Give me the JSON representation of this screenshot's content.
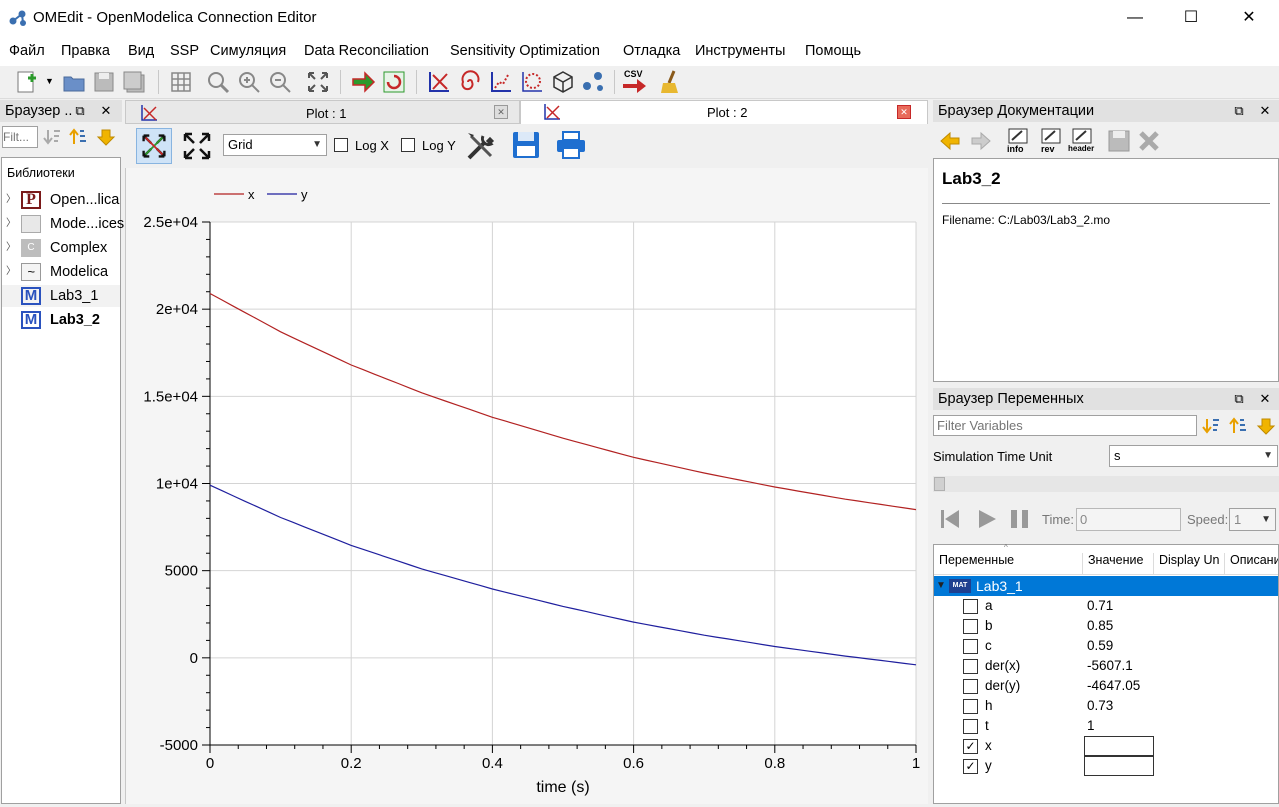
{
  "window": {
    "title": "OMEdit - OpenModelica Connection Editor",
    "minimize": "—",
    "maximize": "☐",
    "close": "✕"
  },
  "menu": [
    "Файл",
    "Правка",
    "Вид",
    "SSP",
    "Симуляция",
    "Data Reconciliation",
    "Sensitivity Optimization",
    "Отладка",
    "Инструменты",
    "Помощь"
  ],
  "toolbar": {
    "csv_label": "CSV"
  },
  "library_browser": {
    "title": "Браузер ..",
    "filter_placeholder": "Filt...",
    "section_label": "Библиотеки",
    "items": [
      {
        "label": "Open...lica",
        "icon": "P"
      },
      {
        "label": "Mode...ices",
        "icon": ""
      },
      {
        "label": "Complex",
        "icon": "C"
      },
      {
        "label": "Modelica",
        "icon": "~"
      },
      {
        "label": "Lab3_1",
        "icon": "M"
      },
      {
        "label": "Lab3_2",
        "icon": "M"
      }
    ]
  },
  "plot_tabs": [
    {
      "label": "Plot : 1",
      "close": "✕"
    },
    {
      "label": "Plot : 2",
      "close": "✕"
    }
  ],
  "plot_toolbar": {
    "grid_value": "Grid",
    "logx_label": "Log X",
    "logy_label": "Log Y"
  },
  "chart_data": {
    "type": "line",
    "xlabel": "time (s)",
    "ylabel": "",
    "xlim": [
      0,
      1
    ],
    "ylim": [
      -5000,
      25000
    ],
    "x_ticks": [
      "0",
      "0.2",
      "0.4",
      "0.6",
      "0.8",
      "1"
    ],
    "y_ticks": [
      "-5000",
      "0",
      "5000",
      "1e+04",
      "1.5e+04",
      "2e+04",
      "2.5e+04"
    ],
    "grid": true,
    "legend": "top-left",
    "x": [
      0,
      0.1,
      0.2,
      0.3,
      0.4,
      0.5,
      0.6,
      0.7,
      0.8,
      0.9,
      1.0
    ],
    "series": [
      {
        "name": "x",
        "color": "#b22222",
        "values": [
          20900,
          18700,
          16800,
          15200,
          13800,
          12600,
          11500,
          10600,
          9800,
          9100,
          8500
        ]
      },
      {
        "name": "y",
        "color": "#1f1f9e",
        "values": [
          9900,
          8050,
          6450,
          5100,
          3950,
          2950,
          2050,
          1300,
          650,
          100,
          -400
        ]
      }
    ]
  },
  "doc_browser": {
    "title": "Браузер Документации",
    "heading": "Lab3_2",
    "filename": "Filename: C:/Lab03/Lab3_2.mo",
    "btn_info": "info",
    "btn_rev": "rev",
    "btn_header": "header"
  },
  "var_browser": {
    "title": "Браузер Переменных",
    "filter_placeholder": "Filter Variables",
    "time_unit_label": "Simulation Time Unit",
    "time_unit_value": "s",
    "time_label": "Time:",
    "time_value": "0",
    "speed_label": "Speed:",
    "speed_value": "1",
    "columns": [
      "Переменные",
      "Значение",
      "Display Un",
      "Описани"
    ],
    "root": "Lab3_1",
    "root_badge": "MAT",
    "rows": [
      {
        "name": "a",
        "value": "0.71",
        "checked": false
      },
      {
        "name": "b",
        "value": "0.85",
        "checked": false
      },
      {
        "name": "c",
        "value": "0.59",
        "checked": false
      },
      {
        "name": "der(x)",
        "value": "-5607.1",
        "checked": false
      },
      {
        "name": "der(y)",
        "value": "-4647.05",
        "checked": false
      },
      {
        "name": "h",
        "value": "0.73",
        "checked": false
      },
      {
        "name": "t",
        "value": "1",
        "checked": false
      },
      {
        "name": "x",
        "value": "",
        "checked": true
      },
      {
        "name": "y",
        "value": "",
        "checked": true
      }
    ]
  }
}
